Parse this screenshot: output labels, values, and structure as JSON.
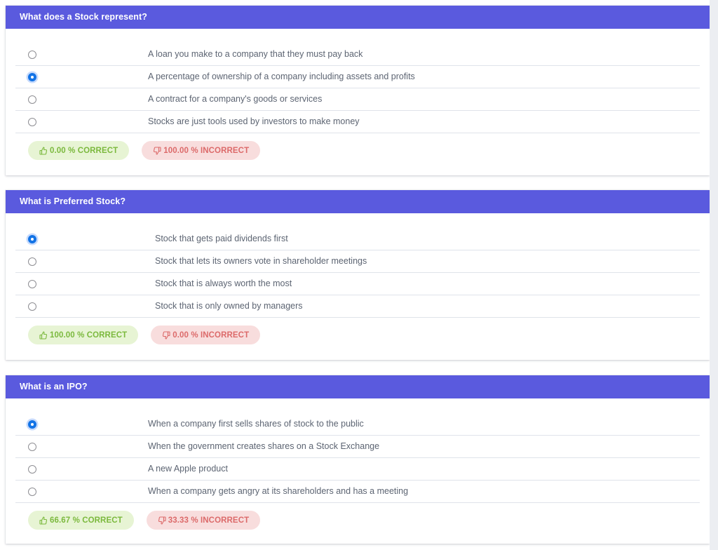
{
  "theme": {
    "header_bg": "#5a5ade",
    "header_text": "#ffffff",
    "page_bg": "#ffffff",
    "gutter_bg": "#eceef2",
    "option_text": "#5c6472",
    "divider": "#dfe3ea",
    "radio_selected": "#1273e6",
    "radio_unselected_border": "#8e8e93",
    "badge_correct_bg": "#e7f4d4",
    "badge_correct_text": "#7bb93d",
    "badge_incorrect_bg": "#f8dddd",
    "badge_incorrect_text": "#dc6a6a"
  },
  "icons": {
    "thumbs_up": "thumbs-up-icon",
    "thumbs_down": "thumbs-down-icon"
  },
  "questions": [
    {
      "title": "What does a Stock represent?",
      "text_indent": "indent-a",
      "options": [
        {
          "label": "A loan you make to a company that they must pay back",
          "selected": false
        },
        {
          "label": "A percentage of ownership of a company including assets and profits",
          "selected": true
        },
        {
          "label": "A contract for a company's goods or services",
          "selected": false
        },
        {
          "label": "Stocks are just tools used by investors to make money",
          "selected": false
        }
      ],
      "correct_label": "0.00 % CORRECT",
      "incorrect_label": "100.00 % INCORRECT",
      "correct_percent": 0.0,
      "incorrect_percent": 100.0
    },
    {
      "title": "What is Preferred Stock?",
      "text_indent": "indent-b",
      "options": [
        {
          "label": "Stock that gets paid dividends first",
          "selected": true
        },
        {
          "label": "Stock that lets its owners vote in shareholder meetings",
          "selected": false
        },
        {
          "label": "Stock that is always worth the most",
          "selected": false
        },
        {
          "label": "Stock that is only owned by managers",
          "selected": false
        }
      ],
      "correct_label": "100.00 % CORRECT",
      "incorrect_label": "0.00 % INCORRECT",
      "correct_percent": 100.0,
      "incorrect_percent": 0.0
    },
    {
      "title": "What is an IPO?",
      "text_indent": "indent-a",
      "options": [
        {
          "label": "When a company first sells shares of stock to the public",
          "selected": true
        },
        {
          "label": "When the government creates shares on a Stock Exchange",
          "selected": false
        },
        {
          "label": "A new Apple product",
          "selected": false
        },
        {
          "label": "When a company gets angry at its shareholders and has a meeting",
          "selected": false
        }
      ],
      "correct_label": "66.67 % CORRECT",
      "incorrect_label": "33.33 % INCORRECT",
      "correct_percent": 66.67,
      "incorrect_percent": 33.33
    }
  ]
}
